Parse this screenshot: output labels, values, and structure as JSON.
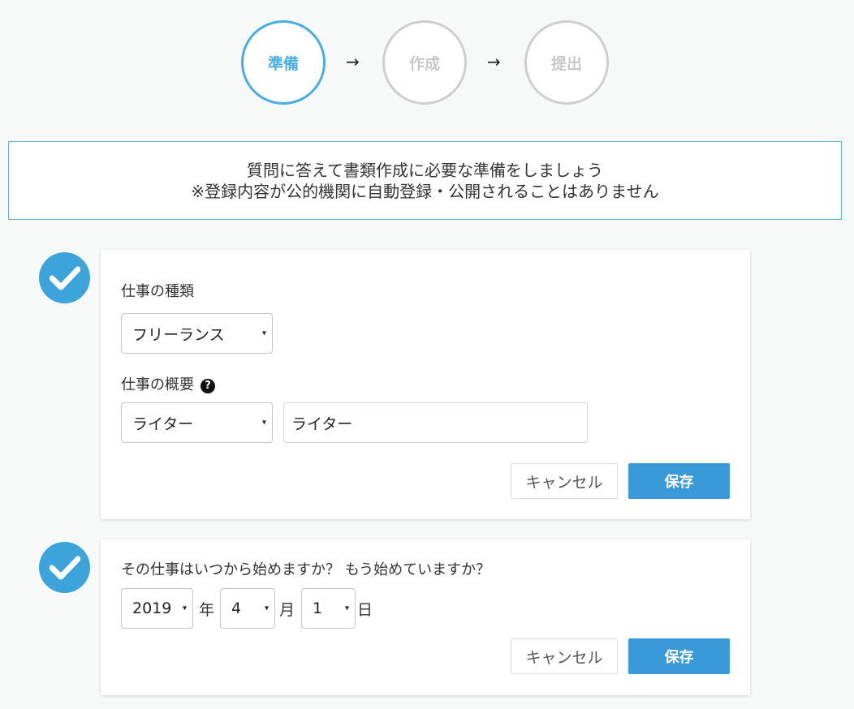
{
  "steps": [
    {
      "label": "準備",
      "active": true
    },
    {
      "label": "作成",
      "active": false
    },
    {
      "label": "提出",
      "active": false
    }
  ],
  "arrow": "→",
  "notice": {
    "line1": "質問に答えて書類作成に必要な準備をしましょう",
    "line2": "※登録内容が公的機関に自動登録・公開されることはありません"
  },
  "card1": {
    "job_type_label": "仕事の種類",
    "job_type_value": "フリーランス",
    "job_summary_label": "仕事の概要",
    "help_icon": "?",
    "job_summary_select": "ライター",
    "job_summary_input": "ライター",
    "cancel_label": "キャンセル",
    "save_label": "保存"
  },
  "card2": {
    "question": "その仕事はいつから始めますか？ もう始めていますか？",
    "year_value": "2019",
    "year_unit": "年",
    "month_value": "4",
    "month_unit": "月",
    "day_value": "1",
    "day_unit": "日",
    "cancel_label": "キャンセル",
    "save_label": "保存"
  },
  "caret": "▾",
  "colors": {
    "accent": "#4aaee0",
    "check_bg": "#3da4db",
    "save_bg": "#3a9ad9",
    "inactive_step": "#cfcfcf"
  }
}
